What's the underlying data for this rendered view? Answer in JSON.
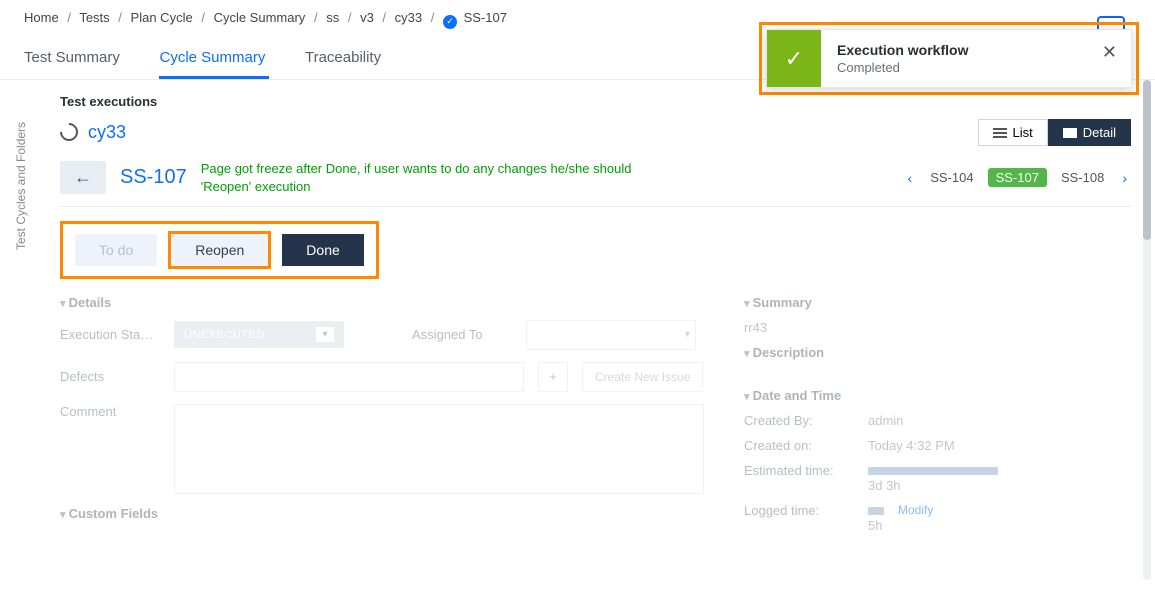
{
  "breadcrumb": {
    "items": [
      "Home",
      "Tests",
      "Plan Cycle",
      "Cycle Summary",
      "ss",
      "v3",
      "cy33"
    ],
    "current": "SS-107"
  },
  "tabs": {
    "t0": "Test Summary",
    "t1": "Cycle Summary",
    "t2": "Traceability"
  },
  "sidelabel": "Test Cycles and Folders",
  "exec": {
    "heading": "Test executions",
    "cycle": "cy33",
    "listBtn": "List",
    "detailBtn": "Detail"
  },
  "ss": {
    "id": "SS-107",
    "annotation": "Page got freeze after Done, if user wants to do any changes he/she should 'Reopen' execution",
    "prev": "SS-104",
    "current": "SS-107",
    "next": "SS-108"
  },
  "actions": {
    "todo": "To do",
    "reopen": "Reopen",
    "done": "Done"
  },
  "details": {
    "heading": "Details",
    "execStatusLabel": "Execution Sta…",
    "execStatusValue": "UNEXECUTED",
    "assignedLabel": "Assigned To",
    "defectsLabel": "Defects",
    "plus": "+",
    "createIssue": "Create New Issue",
    "commentLabel": "Comment",
    "customFields": "Custom Fields"
  },
  "right": {
    "summaryHead": "Summary",
    "summaryVal": "rr43",
    "descriptionHead": "Description",
    "datetimeHead": "Date and Time",
    "createdByL": "Created By:",
    "createdByV": "admin",
    "createdOnL": "Created on:",
    "createdOnV": "Today 4:32 PM",
    "estL": "Estimated time:",
    "estV": "3d 3h",
    "logL": "Logged time:",
    "logV": "5h",
    "modify": "Modify"
  },
  "toast": {
    "title": "Execution workflow",
    "subtitle": "Completed"
  }
}
